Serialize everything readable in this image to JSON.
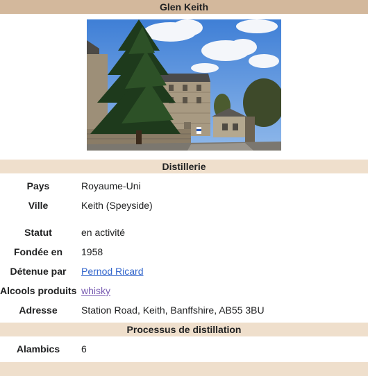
{
  "title": "Glen Keith",
  "image": {
    "alt": "Distillerie Glen Keith"
  },
  "sections": {
    "distillery": "Distillerie",
    "process": "Processus de distillation"
  },
  "rows": {
    "pays": {
      "label": "Pays",
      "value": "Royaume-Uni"
    },
    "ville": {
      "label": "Ville",
      "value": "Keith (Speyside)"
    },
    "statut": {
      "label": "Statut",
      "value": "en activité"
    },
    "fondee": {
      "label": "Fondée en",
      "value": "1958"
    },
    "detenue": {
      "label": "Détenue par",
      "value": "Pernod Ricard"
    },
    "alcools": {
      "label": "Alcools produits",
      "value": "whisky"
    },
    "adresse": {
      "label": "Adresse",
      "value": "Station Road, Keith, Banffshire, AB55 3BU"
    },
    "alambics": {
      "label": "Alambics",
      "value": "6"
    }
  },
  "colors": {
    "title_bg": "#d3b89c",
    "section_bg": "#efdfcc",
    "link": "#3366cc",
    "visited_link": "#795cb2"
  }
}
